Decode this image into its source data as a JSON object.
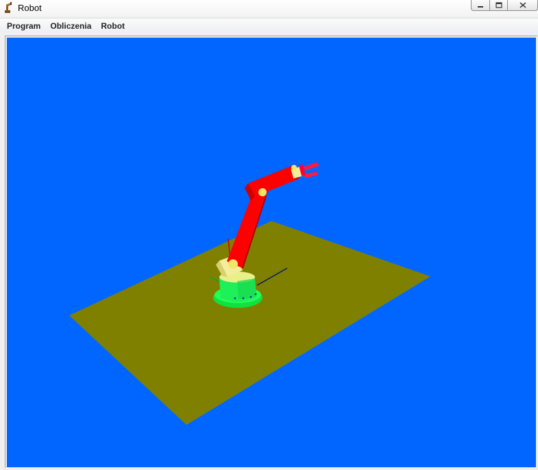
{
  "window": {
    "title": "Robot",
    "app_icon": "robot-arm-icon",
    "caption_buttons": {
      "minimize_icon": "minimize-icon",
      "maximize_icon": "maximize-icon",
      "close_icon": "close-icon"
    }
  },
  "menubar": {
    "items": [
      {
        "label": "Program"
      },
      {
        "label": "Obliczenia"
      },
      {
        "label": "Robot"
      }
    ]
  },
  "scene": {
    "background_color": "#0066ff",
    "floor_color": "#808000",
    "base_color": "#00ee44",
    "arm_color": "#ff0000",
    "joint_color": "#f0e07a"
  }
}
